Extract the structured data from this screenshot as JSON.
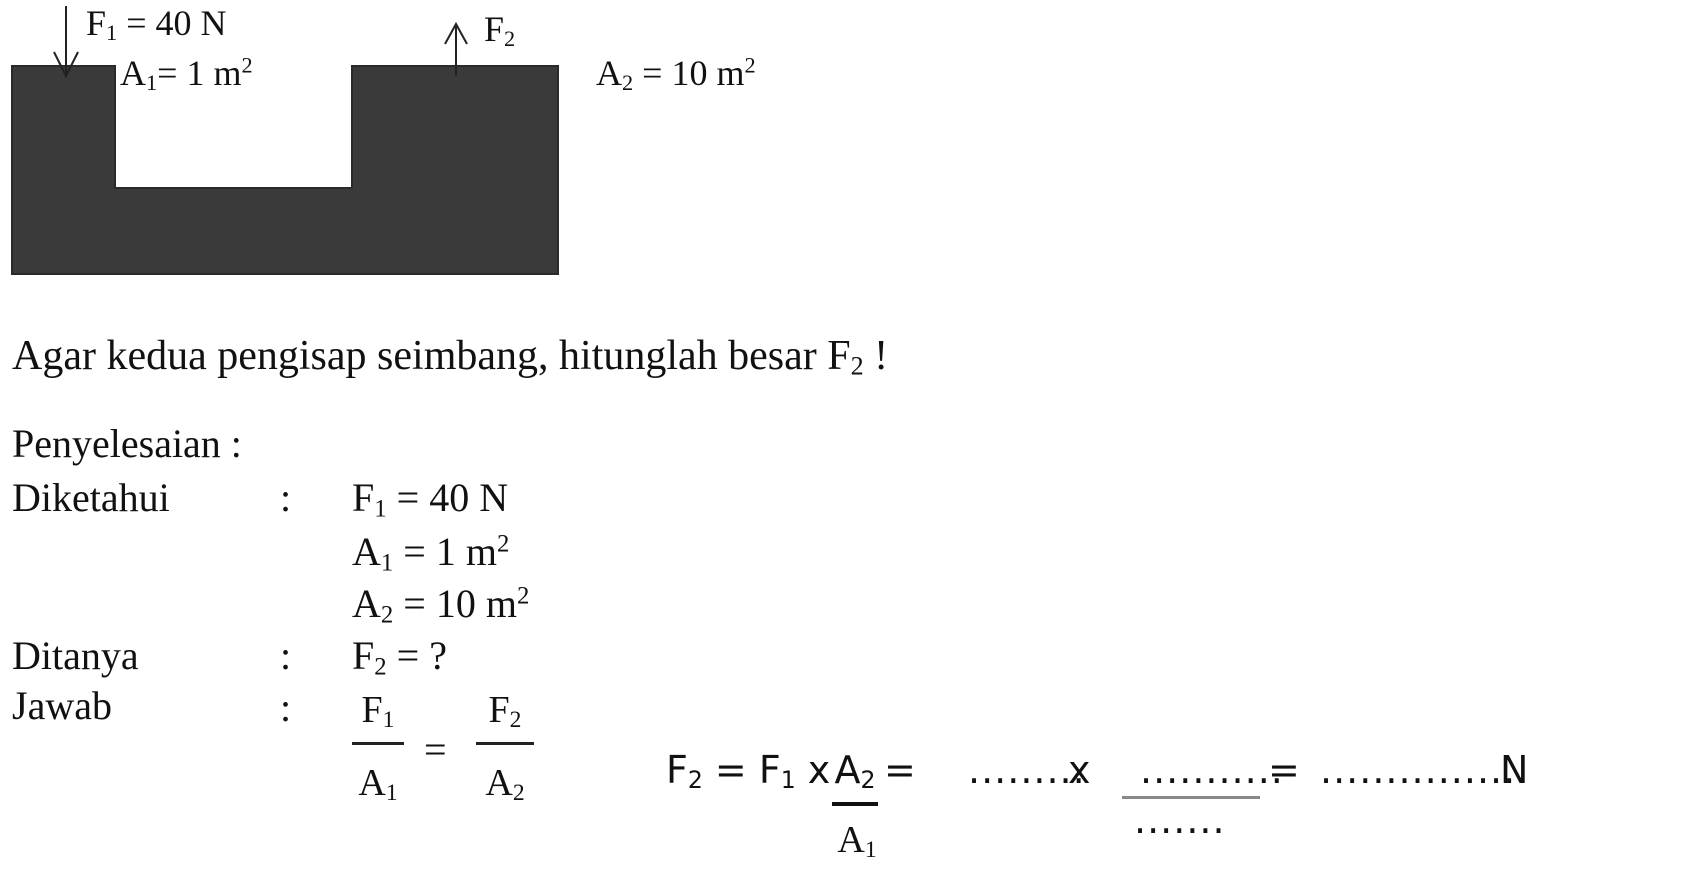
{
  "diagram": {
    "f1_label": "F",
    "f1_sub": "1",
    "f1_value": " = 40 N",
    "a1_label": "A",
    "a1_sub": "1",
    "a1_value": "= 1 m",
    "a1_sup": "2",
    "f2_label": "F",
    "f2_sub": "2",
    "a2_label": "A",
    "a2_sub": "2",
    "a2_value": " = 10 m",
    "a2_sup": "2",
    "fluid_color": "#3a3a3a"
  },
  "question": {
    "text": "Agar kedua pengisap seimbang, hitunglah besar F",
    "sub": "2",
    "end": " !"
  },
  "solution": {
    "heading": "Penyelesaian :",
    "known_label": "Diketahui",
    "asked_label": "Ditanya",
    "answer_label": "Jawab",
    "colon": ":",
    "known": [
      {
        "sym": "F",
        "sub": "1",
        "rest": " = 40 N",
        "sup": ""
      },
      {
        "sym": "A",
        "sub": "1",
        "rest": " = 1 m",
        "sup": "2"
      },
      {
        "sym": "A",
        "sub": "2",
        "rest": " = 10 m",
        "sup": "2"
      }
    ],
    "asked": {
      "sym": "F",
      "sub": "2",
      "rest": " = ?"
    },
    "ratio": {
      "left_num": "F",
      "left_num_sub": "1",
      "left_den": "A",
      "left_den_sub": "1",
      "equals": "=",
      "right_num": "F",
      "right_num_sub": "2",
      "right_den": "A",
      "right_den_sub": "2"
    },
    "formula": {
      "lhs": "F",
      "lhs_sub": "2",
      "eq1": " = ",
      "f": "F",
      "f_sub": "1",
      "times": " x ",
      "num": "A",
      "num_sub": "2",
      "den": "A",
      "den_sub": "1",
      "eq2": " = ",
      "blank1": ".........",
      "times2": " x ",
      "blank_num": "...........",
      "blank_den": ".......",
      "eq3": " = ",
      "blank_result": "...............",
      "unit": " N"
    }
  }
}
